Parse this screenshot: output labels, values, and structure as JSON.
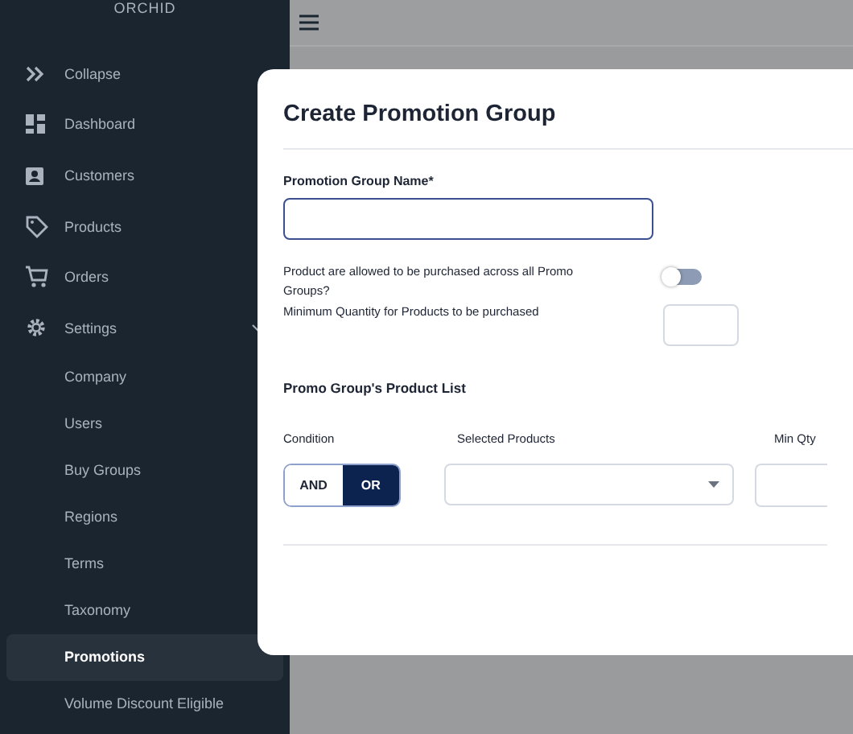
{
  "sidebar": {
    "logo": "ORCHID",
    "items": [
      {
        "label": "Collapse",
        "kind": "collapse",
        "selected": false
      },
      {
        "label": "Dashboard",
        "kind": "dashboard",
        "selected": false
      },
      {
        "label": "Customers",
        "kind": "customers",
        "selected": false
      },
      {
        "label": "Products",
        "kind": "products",
        "selected": false
      },
      {
        "label": "Orders",
        "kind": "orders",
        "selected": false
      },
      {
        "label": "Settings",
        "kind": "settings",
        "selected": false,
        "expanded": true,
        "children": [
          {
            "label": "Company",
            "selected": false
          },
          {
            "label": "Users",
            "selected": false
          },
          {
            "label": "Buy Groups",
            "selected": false
          },
          {
            "label": "Regions",
            "selected": false
          },
          {
            "label": "Terms",
            "selected": false
          },
          {
            "label": "Taxonomy",
            "selected": false
          },
          {
            "label": "Promotions",
            "selected": true
          },
          {
            "label": "Volume Discount Eligible",
            "selected": false
          }
        ]
      }
    ]
  },
  "modal": {
    "title": "Create Promotion Group",
    "name_field": {
      "label": "Promotion Group Name*",
      "focused": true
    },
    "allow_across": {
      "label": "Product are allowed to be purchased across all Promo Groups?",
      "on": false
    },
    "min_quantity": {
      "label": "Minimum Quantity for Products to be purchased"
    },
    "product_list": {
      "title": "Promo Group's Product List",
      "columns": [
        "Condition",
        "Selected Products",
        "Min Qty"
      ],
      "condition_options": [
        {
          "label": "AND",
          "selected": false
        },
        {
          "label": "OR",
          "selected": true
        }
      ]
    }
  }
}
